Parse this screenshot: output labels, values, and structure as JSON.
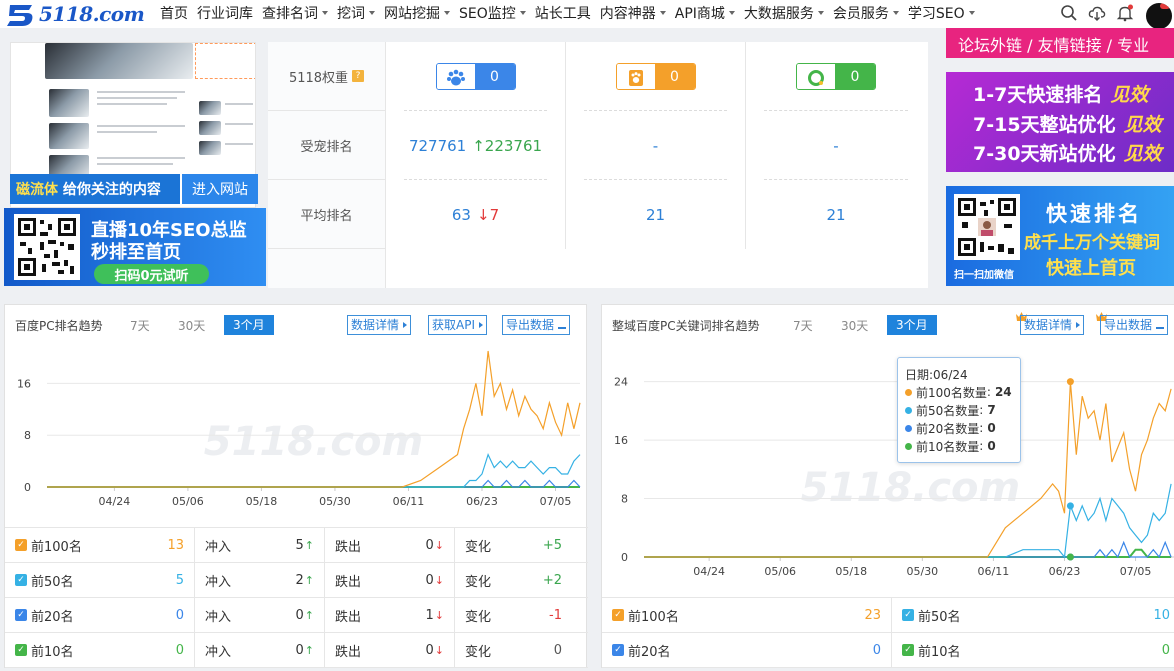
{
  "nav": {
    "logo_text": "5118.com",
    "items": [
      {
        "label": "首页",
        "caret": false
      },
      {
        "label": "行业词库",
        "caret": false
      },
      {
        "label": "查排名词",
        "caret": true
      },
      {
        "label": "挖词",
        "caret": true
      },
      {
        "label": "网站挖掘",
        "caret": true
      },
      {
        "label": "SEO监控",
        "caret": true
      },
      {
        "label": "站长工具",
        "caret": false
      },
      {
        "label": "内容神器",
        "caret": true
      },
      {
        "label": "API商城",
        "caret": true
      },
      {
        "label": "大数据服务",
        "caret": true
      },
      {
        "label": "会员服务",
        "caret": true
      },
      {
        "label": "学习SEO",
        "caret": true
      }
    ]
  },
  "site_banner": {
    "left_text": "磁流体",
    "left_text_rest": " 给你关注的内容",
    "button": "进入网站"
  },
  "live_ad": {
    "line1": "直播10年SEO总监",
    "line2": "秒排至首页",
    "button": "扫码0元试听"
  },
  "metrics": {
    "weight_label": "5118权重",
    "weight_help": "?",
    "weights": [
      {
        "value": "0",
        "color": "#3b86e8",
        "icon": "paw-icon"
      },
      {
        "value": "0",
        "color": "#f4a02a",
        "icon": "paw-icon"
      },
      {
        "value": "0",
        "color": "#44b549",
        "icon": "ring-icon"
      }
    ],
    "traffic_label": "受宠排名",
    "traffic": [
      {
        "value": "727761",
        "delta": "223761",
        "dir": "up"
      },
      {
        "value": "-",
        "delta": "",
        "dir": ""
      },
      {
        "value": "-",
        "delta": "",
        "dir": ""
      }
    ],
    "avg_label": "平均排名",
    "avg": [
      {
        "value": "63",
        "delta": "7",
        "dir": "down"
      },
      {
        "value": "21",
        "delta": "",
        "dir": ""
      },
      {
        "value": "21",
        "delta": "",
        "dir": ""
      }
    ]
  },
  "right_ads": {
    "top_text": "论坛外链 / 友情链接 / 专业",
    "ad1_rows": [
      {
        "text": "1-7天快速排名",
        "tag": "见效"
      },
      {
        "text": "7-15天整站优化",
        "tag": "见效"
      },
      {
        "text": "7-30天新站优化",
        "tag": "见效"
      }
    ],
    "ad2_title": "快速排名",
    "ad2_line2": "成千上万个关键词",
    "ad2_line3": "快速上首页",
    "ad2_qr_caption": "扫一扫加微信"
  },
  "left_panel": {
    "title": "百度PC排名趋势",
    "tabs": [
      "7天",
      "30天",
      "3个月"
    ],
    "active_tab": "3个月",
    "buttons": [
      "数据详情",
      "获取API",
      "导出数据"
    ],
    "watermark": "5118.com",
    "rows": [
      {
        "name": "前100名",
        "color": "#f4a02a",
        "count": "13",
        "count_color": "#f4a02a",
        "in_label": "冲入",
        "in": "5",
        "out_label": "跌出",
        "out": "0",
        "chg_label": "变化",
        "chg": "+5",
        "chg_color": "#3aa64e"
      },
      {
        "name": "前50名",
        "color": "#35b1e4",
        "count": "5",
        "count_color": "#35b1e4",
        "in_label": "冲入",
        "in": "2",
        "out_label": "跌出",
        "out": "0",
        "chg_label": "变化",
        "chg": "+2",
        "chg_color": "#3aa64e"
      },
      {
        "name": "前20名",
        "color": "#3b86e8",
        "count": "0",
        "count_color": "#3b86e8",
        "in_label": "冲入",
        "in": "0",
        "out_label": "跌出",
        "out": "1",
        "chg_label": "变化",
        "chg": "-1",
        "chg_color": "#e23a3a"
      },
      {
        "name": "前10名",
        "color": "#44b549",
        "count": "0",
        "count_color": "#44b549",
        "in_label": "冲入",
        "in": "0",
        "out_label": "跌出",
        "out": "0",
        "chg_label": "变化",
        "chg": "0",
        "chg_color": "#555"
      }
    ]
  },
  "right_panel": {
    "title": "整域百度PC关键词排名趋势",
    "tabs": [
      "7天",
      "30天",
      "3个月"
    ],
    "active_tab": "3个月",
    "buttons": [
      "数据详情",
      "导出数据"
    ],
    "watermark": "5118.com",
    "tooltip": {
      "date": "日期:06/24",
      "rows": [
        {
          "label": "前100名数量",
          "value": "24",
          "color": "#f4a02a"
        },
        {
          "label": "前50名数量",
          "value": "7",
          "color": "#35b1e4"
        },
        {
          "label": "前20名数量",
          "value": "0",
          "color": "#3b86e8"
        },
        {
          "label": "前10名数量",
          "value": "0",
          "color": "#44b549"
        }
      ]
    },
    "rows": [
      {
        "name": "前100名",
        "color": "#f4a02a",
        "count": "23",
        "count_color": "#f4a02a",
        "name2": "前50名",
        "color2": "#35b1e4",
        "count2": "10",
        "count2_color": "#35b1e4"
      },
      {
        "name": "前20名",
        "color": "#3b86e8",
        "count": "0",
        "count_color": "#3b86e8",
        "name2": "前10名",
        "color2": "#44b549",
        "count2": "0",
        "count2_color": "#44b549"
      }
    ]
  },
  "chart_data": [
    {
      "type": "line",
      "title": "百度PC排名趋势",
      "x_ticks": [
        "04/24",
        "05/06",
        "05/18",
        "05/30",
        "06/11",
        "06/23",
        "07/05"
      ],
      "y_ticks": [
        0,
        8,
        16
      ],
      "ylim": [
        0,
        21
      ],
      "x_range": [
        "04/13",
        "07/09"
      ],
      "grid": true,
      "legend": "none",
      "x": [
        "04/13",
        "06/10",
        "06/13",
        "06/16",
        "06/19",
        "06/20",
        "06/21",
        "06/22",
        "06/23",
        "06/24",
        "06/25",
        "06/26",
        "06/27",
        "06/28",
        "06/29",
        "06/30",
        "07/01",
        "07/02",
        "07/03",
        "07/04",
        "07/05",
        "07/06",
        "07/07",
        "07/08",
        "07/09"
      ],
      "series": [
        {
          "name": "前100名",
          "color": "#f4a02a",
          "values": [
            0,
            0,
            1,
            3,
            5,
            9,
            12,
            16,
            11,
            21,
            14,
            16,
            12,
            15,
            11,
            14,
            12,
            11,
            9,
            13,
            10,
            8,
            13,
            9,
            13
          ]
        },
        {
          "name": "前50名",
          "color": "#35b1e4",
          "values": [
            0,
            0,
            0,
            0,
            0,
            0,
            1,
            1,
            2,
            5,
            3,
            4,
            3,
            4,
            3,
            3,
            4,
            3,
            2,
            3,
            3,
            2,
            2,
            4,
            5
          ]
        },
        {
          "name": "前20名",
          "color": "#3b86e8",
          "values": [
            0,
            0,
            0,
            0,
            0,
            0,
            0,
            0,
            0,
            1,
            0,
            0,
            1,
            0,
            0,
            1,
            0,
            0,
            0,
            1,
            0,
            0,
            0,
            1,
            0
          ]
        },
        {
          "name": "前10名",
          "color": "#44b549",
          "values": [
            0,
            0,
            0,
            0,
            0,
            0,
            0,
            0,
            0,
            0,
            0,
            0,
            0,
            0,
            0,
            0,
            0,
            0,
            0,
            0,
            0,
            0,
            0,
            0,
            0
          ]
        }
      ]
    },
    {
      "type": "line",
      "title": "整域百度PC关键词排名趋势",
      "x_ticks": [
        "04/24",
        "05/06",
        "05/18",
        "05/30",
        "06/11",
        "06/23",
        "07/05"
      ],
      "y_ticks": [
        0,
        8,
        16,
        24
      ],
      "ylim": [
        0,
        26
      ],
      "x_range": [
        "04/13",
        "07/12"
      ],
      "grid": true,
      "legend": "none",
      "x": [
        "04/13",
        "06/10",
        "06/13",
        "06/16",
        "06/19",
        "06/21",
        "06/22",
        "06/23",
        "06/24",
        "06/25",
        "06/26",
        "06/27",
        "06/28",
        "06/29",
        "06/30",
        "07/01",
        "07/02",
        "07/03",
        "07/04",
        "07/05",
        "07/06",
        "07/07",
        "07/08",
        "07/09",
        "07/10",
        "07/11"
      ],
      "series": [
        {
          "name": "前100名",
          "color": "#f4a02a",
          "values": [
            0,
            0,
            4,
            6,
            8,
            10,
            9,
            6,
            24,
            14,
            22,
            19,
            20,
            16,
            21,
            13,
            15,
            17,
            12,
            9,
            14,
            16,
            19,
            21,
            20,
            23
          ]
        },
        {
          "name": "前50名",
          "color": "#35b1e4",
          "values": [
            0,
            0,
            0,
            1,
            1,
            1,
            1,
            0,
            7,
            5,
            7,
            5,
            6,
            8,
            5,
            8,
            7,
            6,
            4,
            3,
            2,
            3,
            6,
            5,
            6,
            10
          ]
        },
        {
          "name": "前20名",
          "color": "#3b86e8",
          "values": [
            0,
            0,
            0,
            0,
            0,
            0,
            0,
            0,
            0,
            0,
            0,
            0,
            0,
            1,
            0,
            1,
            0,
            2,
            0,
            0,
            0,
            0,
            1,
            0,
            2,
            0
          ]
        },
        {
          "name": "前10名",
          "color": "#44b549",
          "values": [
            0,
            0,
            0,
            0,
            0,
            0,
            0,
            0,
            0,
            0,
            0,
            0,
            0,
            0,
            0,
            0,
            0,
            0,
            0,
            1,
            1,
            0,
            0,
            0,
            0,
            0
          ]
        }
      ]
    }
  ]
}
